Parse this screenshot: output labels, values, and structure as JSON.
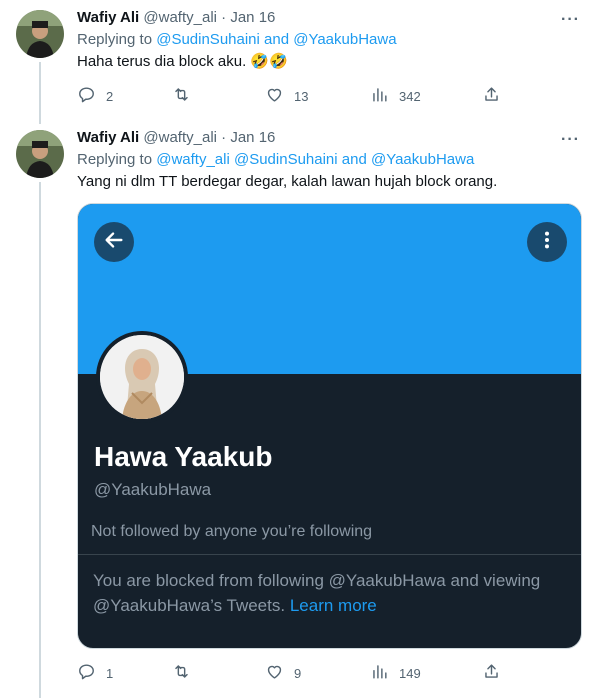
{
  "tweets": [
    {
      "name": "Wafiy Ali",
      "handle": "@wafty_ali",
      "dot": "·",
      "date": "Jan 16",
      "replying_prefix": "Replying to ",
      "replying_mentions": "@SudinSuhaini and @YaakubHawa",
      "text": "Haha terus dia block aku. 🤣🤣",
      "more": "···",
      "actions": {
        "replies": "2",
        "retweets": "",
        "likes": "13",
        "views": "342"
      }
    },
    {
      "name": "Wafiy Ali",
      "handle": "@wafty_ali",
      "dot": "·",
      "date": "Jan 16",
      "replying_prefix": "Replying to ",
      "replying_mentions": "@wafty_ali @SudinSuhaini and @YaakubHawa",
      "text": "Yang ni dlm TT berdegar degar, kalah lawan hujah block orang.",
      "more": "···",
      "actions": {
        "replies": "1",
        "retweets": "",
        "likes": "9",
        "views": "149"
      }
    }
  ],
  "embedded_profile": {
    "name": "Hawa Yaakub",
    "handle": "@YaakubHawa",
    "followed_status": "Not followed by anyone you’re following",
    "blocked_text": "You are blocked from following @YaakubHawa and viewing @YaakubHawa’s Tweets.",
    "learn_more": "Learn more"
  },
  "colors": {
    "accent": "#1d9bf0",
    "dark_bg": "#15202b",
    "muted_text": "#536471"
  },
  "icons": {
    "reply": "reply-icon",
    "retweet": "retweet-icon",
    "like": "heart-icon",
    "views": "views-icon",
    "share": "share-icon",
    "back": "back-arrow-icon",
    "menu": "more-vertical-icon"
  }
}
